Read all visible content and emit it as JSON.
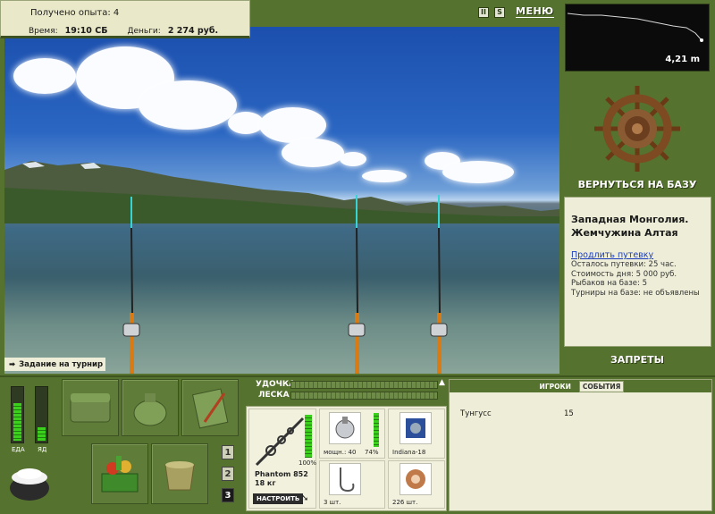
{
  "info": {
    "experience_label": "Получено опыта:",
    "experience_value": "4",
    "time_label": "Время:",
    "time_value": "19:10 СБ",
    "money_label": "Деньги:",
    "money_value": "2 274 руб."
  },
  "top_controls": {
    "pause_label": "II",
    "sound_label": "S",
    "menu_label": "МЕНЮ"
  },
  "depth": {
    "value": "4,21 m"
  },
  "right_panel": {
    "return_label": "ВЕРНУТЬСЯ НА БАЗУ",
    "location_name": "Западная Монголия. Жемчужина Алтая",
    "extend_link": "Продлить путевку",
    "lines": [
      "Осталось путевки: 25 час.",
      "Стоимость дня: 5 000 руб.",
      "Рыбаков на базе: 5",
      "Турниры на базе: не объявлены"
    ],
    "bans_label": "ЗАПРЕТЫ"
  },
  "task": {
    "label": "Задание на турнир"
  },
  "meters": {
    "food_label": "ЕДА",
    "poison_label": "ЯД",
    "food_level": 0.7,
    "poison_level": 0.25
  },
  "slots": {
    "page_buttons": [
      "1",
      "2",
      "3"
    ]
  },
  "gear": {
    "rod_label": "УДОЧКА",
    "line_label": "ЛЕСКА",
    "rod_name": "Phantom 852",
    "rod_weight": "18 кг",
    "rod_health": "100%",
    "setup_label": "НАСТРОИТЬ",
    "reel_power": "мощн.: 40",
    "reel_health": "74%",
    "line_name": "Indiana-18",
    "hooks_count": "3 шт.",
    "bait_count": "226 шт."
  },
  "events": {
    "tab_players": "ИГРОКИ",
    "tab_events": "СОБЫТИЯ",
    "player_name": "Тунгусс",
    "player_value": "15"
  },
  "colors": {
    "panel_green": "#56722f",
    "panel_light": "#eeeed8",
    "meter_green": "#3bd01b"
  }
}
